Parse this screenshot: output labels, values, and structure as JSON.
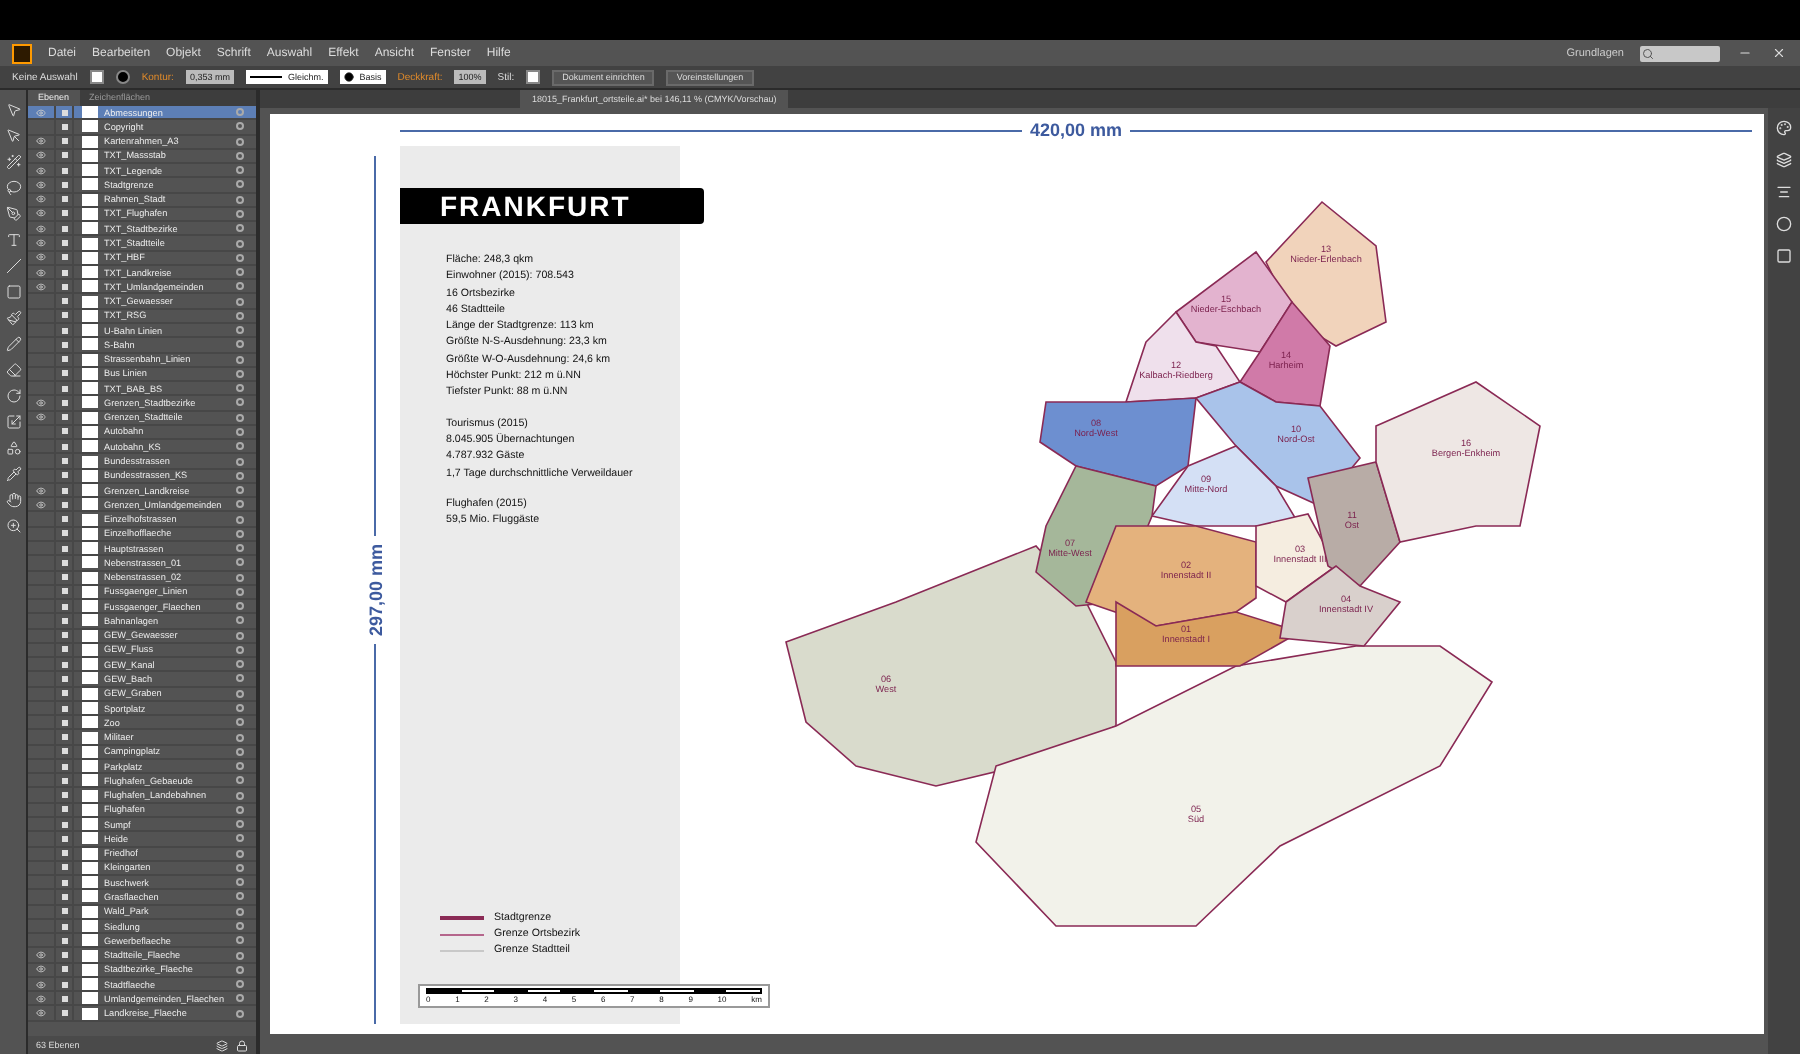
{
  "menu": [
    "Datei",
    "Bearbeiten",
    "Objekt",
    "Schrift",
    "Auswahl",
    "Effekt",
    "Ansicht",
    "Fenster",
    "Hilfe"
  ],
  "workspace": "Grundlagen",
  "control_bar": {
    "selection": "Keine Auswahl",
    "stroke_label": "Kontur:",
    "stroke_value": "0,353 mm",
    "profile": "Gleichm.",
    "brush": "Basis",
    "opacity_label": "Deckkraft:",
    "opacity_value": "100%",
    "style_label": "Stil:",
    "buttons": [
      "Dokument einrichten",
      "Voreinstellungen"
    ]
  },
  "document_tab": "18015_Frankfurt_ortsteile.ai* bei 146,11 % (CMYK/Vorschau)",
  "layers_panel": {
    "tabs": [
      {
        "label": "Ebenen",
        "selected": true
      },
      {
        "label": "Zeichenflächen",
        "selected": false
      }
    ],
    "layers": [
      {
        "name": "Abmessungen",
        "visible": true,
        "selected": true
      },
      {
        "name": "Copyright",
        "visible": false,
        "selected": false
      },
      {
        "name": "Kartenrahmen_A3",
        "visible": true,
        "selected": false
      },
      {
        "name": "TXT_Massstab",
        "visible": true,
        "selected": false
      },
      {
        "name": "TXT_Legende",
        "visible": true,
        "selected": false
      },
      {
        "name": "Stadtgrenze",
        "visible": true,
        "selected": false
      },
      {
        "name": "Rahmen_Stadt",
        "visible": true,
        "selected": false
      },
      {
        "name": "TXT_Flughafen",
        "visible": true,
        "selected": false
      },
      {
        "name": "TXT_Stadtbezirke",
        "visible": true,
        "selected": false
      },
      {
        "name": "TXT_Stadtteile",
        "visible": true,
        "selected": false
      },
      {
        "name": "TXT_HBF",
        "visible": true,
        "selected": false
      },
      {
        "name": "TXT_Landkreise",
        "visible": true,
        "selected": false
      },
      {
        "name": "TXT_Umlandgemeinden",
        "visible": true,
        "selected": false
      },
      {
        "name": "TXT_Gewaesser",
        "visible": false,
        "selected": false
      },
      {
        "name": "TXT_RSG",
        "visible": false,
        "selected": false
      },
      {
        "name": "U-Bahn Linien",
        "visible": false,
        "selected": false
      },
      {
        "name": "S-Bahn",
        "visible": false,
        "selected": false
      },
      {
        "name": "Strassenbahn_Linien",
        "visible": false,
        "selected": false
      },
      {
        "name": "Bus Linien",
        "visible": false,
        "selected": false
      },
      {
        "name": "TXT_BAB_BS",
        "visible": false,
        "selected": false
      },
      {
        "name": "Grenzen_Stadtbezirke",
        "visible": true,
        "selected": false
      },
      {
        "name": "Grenzen_Stadtteile",
        "visible": true,
        "selected": false
      },
      {
        "name": "Autobahn",
        "visible": false,
        "selected": false
      },
      {
        "name": "Autobahn_KS",
        "visible": false,
        "selected": false
      },
      {
        "name": "Bundesstrassen",
        "visible": false,
        "selected": false
      },
      {
        "name": "Bundesstrassen_KS",
        "visible": false,
        "selected": false
      },
      {
        "name": "Grenzen_Landkreise",
        "visible": true,
        "selected": false
      },
      {
        "name": "Grenzen_Umlandgemeinden",
        "visible": true,
        "selected": false
      },
      {
        "name": "Einzelhofstrassen",
        "visible": false,
        "selected": false
      },
      {
        "name": "Einzelhofflaeche",
        "visible": false,
        "selected": false
      },
      {
        "name": "Hauptstrassen",
        "visible": false,
        "selected": false
      },
      {
        "name": "Nebenstrassen_01",
        "visible": false,
        "selected": false
      },
      {
        "name": "Nebenstrassen_02",
        "visible": false,
        "selected": false
      },
      {
        "name": "Fussgaenger_Linien",
        "visible": false,
        "selected": false
      },
      {
        "name": "Fussgaenger_Flaechen",
        "visible": false,
        "selected": false
      },
      {
        "name": "Bahnanlagen",
        "visible": false,
        "selected": false
      },
      {
        "name": "GEW_Gewaesser",
        "visible": false,
        "selected": false
      },
      {
        "name": "GEW_Fluss",
        "visible": false,
        "selected": false
      },
      {
        "name": "GEW_Kanal",
        "visible": false,
        "selected": false
      },
      {
        "name": "GEW_Bach",
        "visible": false,
        "selected": false
      },
      {
        "name": "GEW_Graben",
        "visible": false,
        "selected": false
      },
      {
        "name": "Sportplatz",
        "visible": false,
        "selected": false
      },
      {
        "name": "Zoo",
        "visible": false,
        "selected": false
      },
      {
        "name": "Militaer",
        "visible": false,
        "selected": false
      },
      {
        "name": "Campingplatz",
        "visible": false,
        "selected": false
      },
      {
        "name": "Parkplatz",
        "visible": false,
        "selected": false
      },
      {
        "name": "Flughafen_Gebaeude",
        "visible": false,
        "selected": false
      },
      {
        "name": "Flughafen_Landebahnen",
        "visible": false,
        "selected": false
      },
      {
        "name": "Flughafen",
        "visible": false,
        "selected": false
      },
      {
        "name": "Sumpf",
        "visible": false,
        "selected": false
      },
      {
        "name": "Heide",
        "visible": false,
        "selected": false
      },
      {
        "name": "Friedhof",
        "visible": false,
        "selected": false
      },
      {
        "name": "Kleingarten",
        "visible": false,
        "selected": false
      },
      {
        "name": "Buschwerk",
        "visible": false,
        "selected": false
      },
      {
        "name": "Grasflaechen",
        "visible": false,
        "selected": false
      },
      {
        "name": "Wald_Park",
        "visible": false,
        "selected": false
      },
      {
        "name": "Siedlung",
        "visible": false,
        "selected": false
      },
      {
        "name": "Gewerbeflaeche",
        "visible": false,
        "selected": false
      },
      {
        "name": "Stadtteile_Flaeche",
        "visible": true,
        "selected": false
      },
      {
        "name": "Stadtbezirke_Flaeche",
        "visible": true,
        "selected": false
      },
      {
        "name": "Stadtflaeche",
        "visible": true,
        "selected": false
      },
      {
        "name": "Umlandgemeinden_Flaechen",
        "visible": true,
        "selected": false
      },
      {
        "name": "Landkreise_Flaeche",
        "visible": true,
        "selected": false
      }
    ],
    "footer": "63 Ebenen"
  },
  "artboard": {
    "width_dimension": "420,00 mm",
    "height_dimension": "297,00 mm",
    "title": "FRANKFURT",
    "fact_groups": [
      [
        "Fläche: 248,3 qkm",
        "Einwohner (2015): 708.543",
        "16 Ortsbezirke",
        "46 Stadtteile",
        "Länge der Stadtgrenze: 113 km",
        "Größte N-S-Ausdehnung: 23,3 km",
        "Größte W-O-Ausdehnung: 24,6 km",
        "Höchster Punkt: 212 m ü.NN",
        "Tiefster Punkt: 88 m ü.NN"
      ],
      [
        "Tourismus (2015)",
        "8.045.905 Übernachtungen",
        "4.787.932 Gäste",
        "1,7 Tage durchschnittliche Verweildauer"
      ],
      [
        "Flughafen (2015)",
        "59,5 Mio. Fluggäste"
      ]
    ],
    "legend": [
      {
        "label": "Stadtgrenze",
        "color": "#8a2a55"
      },
      {
        "label": "Grenze Ortsbezirk",
        "color": "#b5668c"
      },
      {
        "label": "Grenze Stadtteil",
        "color": "#c8c8c8"
      }
    ],
    "scale_bar": {
      "ticks": [
        "0",
        "1",
        "2",
        "3",
        "4",
        "5",
        "6",
        "7",
        "8",
        "9",
        "10"
      ],
      "unit": "km"
    },
    "districts": [
      {
        "number": "06",
        "name": "West",
        "color": "#d9dbcc"
      },
      {
        "number": "05",
        "name": "Süd",
        "color": "#f2f2ea"
      },
      {
        "number": "13",
        "name": "Nieder-Erlenbach",
        "color": "#f1d3bb"
      },
      {
        "number": "15",
        "name": "Nieder-Eschbach",
        "color": "#e3b3cf"
      },
      {
        "number": "14",
        "name": "Harheim",
        "color": "#d07aa8"
      },
      {
        "number": "12",
        "name": "Kalbach-Riedberg",
        "color": "#efe0ec"
      },
      {
        "number": "08",
        "name": "Nord-West",
        "color": "#6d8fd0"
      },
      {
        "number": "10",
        "name": "Nord-Ost",
        "color": "#a9c3ea"
      },
      {
        "number": "09",
        "name": "Mitte-Nord",
        "color": "#d4e0f5"
      },
      {
        "number": "07",
        "name": "Mitte-West",
        "color": "#a5b79a"
      },
      {
        "number": "02",
        "name": "Innenstadt II",
        "color": "#e4b27d"
      },
      {
        "number": "01",
        "name": "Innenstadt I",
        "color": "#d9a060"
      },
      {
        "number": "03",
        "name": "Innenstadt III",
        "color": "#f5ede0"
      },
      {
        "number": "11",
        "name": "Ost",
        "color": "#b8aca6"
      },
      {
        "number": "04",
        "name": "Innenstadt IV",
        "color": "#d9d0cc"
      },
      {
        "number": "16",
        "name": "Bergen-Enkheim",
        "color": "#eee7e4"
      }
    ]
  }
}
